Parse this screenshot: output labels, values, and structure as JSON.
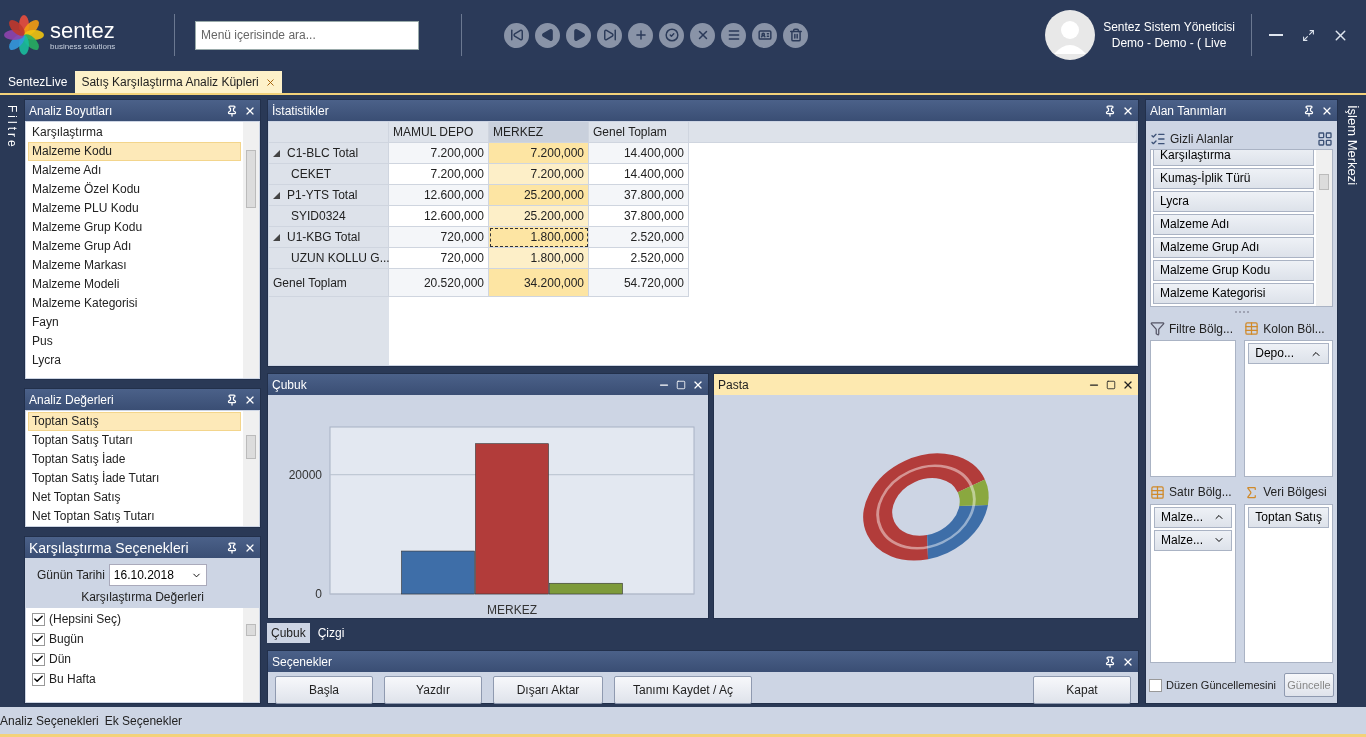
{
  "header": {
    "logo": {
      "name": "sentez",
      "tagline": "business solutions"
    },
    "search": {
      "placeholder": "Menü içerisinde ara..."
    },
    "toolbar": [
      {
        "kind": "first"
      },
      {
        "kind": "previous"
      },
      {
        "kind": "next"
      },
      {
        "kind": "last"
      },
      {
        "kind": "add"
      },
      {
        "kind": "approve"
      },
      {
        "kind": "cancel"
      },
      {
        "kind": "list"
      },
      {
        "kind": "card"
      },
      {
        "kind": "delete"
      }
    ],
    "user": {
      "name": "Sentez Sistem Yöneticisi",
      "context": "Demo - Demo - ( Live"
    }
  },
  "tabs": [
    {
      "label": "SentezLive",
      "selected": false
    },
    {
      "label": "Satış Karşılaştırma Analiz Küpleri",
      "selected": true
    }
  ],
  "left_strip": {
    "label": "Filtre"
  },
  "dimensions_panel": {
    "title": "Analiz Boyutları",
    "items": [
      {
        "label": "Karşılaştırma",
        "selected": false
      },
      {
        "label": "Malzeme Kodu",
        "selected": true
      },
      {
        "label": "Malzeme Adı",
        "selected": false
      },
      {
        "label": "Malzeme Özel Kodu",
        "selected": false
      },
      {
        "label": "Malzeme PLU Kodu",
        "selected": false
      },
      {
        "label": "Malzeme Grup Kodu",
        "selected": false
      },
      {
        "label": "Malzeme Grup Adı",
        "selected": false
      },
      {
        "label": "Malzeme Markası",
        "selected": false
      },
      {
        "label": "Malzeme Modeli",
        "selected": false
      },
      {
        "label": "Malzeme Kategorisi",
        "selected": false
      },
      {
        "label": "Fayn",
        "selected": false
      },
      {
        "label": "Pus",
        "selected": false
      },
      {
        "label": "Lycra",
        "selected": false
      }
    ]
  },
  "values_panel": {
    "title": "Analiz Değerleri",
    "items": [
      {
        "label": "Toptan Satış",
        "selected": true
      },
      {
        "label": "Toptan Satış Tutarı",
        "selected": false
      },
      {
        "label": "Toptan Satış İade",
        "selected": false
      },
      {
        "label": "Toptan Satış İade Tutarı",
        "selected": false
      },
      {
        "label": "Net Toptan Satış",
        "selected": false
      },
      {
        "label": "Net Toptan Satış Tutarı",
        "selected": false
      }
    ]
  },
  "compare_panel": {
    "title": "Karşılaştırma Seçenekleri",
    "date_label": "Günün Tarihi",
    "date": "16.10.2018",
    "subtitle": "Karşılaştırma Değerleri",
    "items": [
      {
        "label": "(Hepsini Seç)",
        "checked": true
      },
      {
        "label": "Bugün",
        "checked": true
      },
      {
        "label": "Dün",
        "checked": true
      },
      {
        "label": "Bu Hafta",
        "checked": true
      }
    ]
  },
  "stats_panel": {
    "title": "İstatistikler",
    "columns": [
      {
        "label": "MAMUL DEPO",
        "selected": false
      },
      {
        "label": "MERKEZ",
        "selected": true
      },
      {
        "label": "Genel Toplam",
        "selected": false
      }
    ],
    "rows": [
      {
        "kind": "group",
        "label": "C1-BLC Total",
        "expanded": true,
        "focused": false,
        "cells": [
          "7.200,000",
          "7.200,000",
          "14.400,000"
        ]
      },
      {
        "kind": "item",
        "label": "CEKET",
        "focused": false,
        "cells": [
          "7.200,000",
          "7.200,000",
          "14.400,000"
        ]
      },
      {
        "kind": "group",
        "label": "P1-YTS Total",
        "expanded": true,
        "focused": false,
        "cells": [
          "12.600,000",
          "25.200,000",
          "37.800,000"
        ]
      },
      {
        "kind": "item",
        "label": "SYID0324",
        "focused": false,
        "cells": [
          "12.600,000",
          "25.200,000",
          "37.800,000"
        ]
      },
      {
        "kind": "group",
        "label": "U1-KBG Total",
        "expanded": true,
        "focused": true,
        "cells": [
          "720,000",
          "1.800,000",
          "2.520,000"
        ]
      },
      {
        "kind": "item",
        "label": "UZUN KOLLU G...",
        "focused": false,
        "cells": [
          "720,000",
          "1.800,000",
          "2.520,000"
        ]
      },
      {
        "kind": "grand",
        "label": "Genel Toplam",
        "focused": false,
        "cells": [
          "20.520,000",
          "34.200,000",
          "54.720,000"
        ]
      }
    ]
  },
  "bar_panel": {
    "title": "Çubuk",
    "active": false,
    "chart_data": {
      "type": "bar",
      "categories": [
        "MERKEZ"
      ],
      "ylim": [
        0,
        28000
      ],
      "yticks": [
        0,
        20000
      ],
      "series": [
        {
          "color": "#3e6ea8",
          "values": [
            7200
          ]
        },
        {
          "color": "#b23c3a",
          "values": [
            25200
          ]
        },
        {
          "color": "#7d9a3a",
          "values": [
            1800
          ]
        }
      ]
    }
  },
  "pie_panel": {
    "title": "Pasta",
    "active": true
  },
  "chart_tabs": [
    {
      "label": "Çubuk",
      "selected": true
    },
    {
      "label": "Çizgi",
      "selected": false
    }
  ],
  "options_panel": {
    "title": "Seçenekler",
    "buttons": [
      "Başla",
      "Yazdır",
      "Dışarı Aktar",
      "Tanımı Kaydet / Aç"
    ],
    "close_button": "Kapat"
  },
  "fields_panel": {
    "title": "Alan Tanımları",
    "hidden_title": "Gizli Alanlar",
    "hidden_fields": [
      "Karşılaştırma",
      "Kumaş-İplik Türü",
      "Lycra",
      "Malzeme Adı",
      "Malzeme Grup Adı",
      "Malzeme Grup Kodu",
      "Malzeme Kategorisi"
    ],
    "areas": [
      {
        "kind": "filter",
        "title": "Filtre Bölg..."
      },
      {
        "kind": "column",
        "title": "Kolon Böl...",
        "fields": [
          {
            "label": "Depo...",
            "ascending": true
          }
        ]
      },
      {
        "kind": "row",
        "title": "Satır Bölg...",
        "fields": [
          {
            "label": "Malze...",
            "ascending": true
          },
          {
            "label": "Malze...",
            "ascending": false
          }
        ]
      },
      {
        "kind": "data",
        "title": "Veri Bölgesi",
        "fields": [
          {
            "label": "Toptan Satış"
          }
        ]
      }
    ],
    "defer": {
      "label": "Düzen Güncellemesini",
      "checked": false
    },
    "update_button": "Güncelle"
  },
  "right_strip": {
    "label": "İşlem Merkezi"
  },
  "status_bar": [
    "Analiz Seçenekleri",
    "Ek Seçenekler"
  ]
}
